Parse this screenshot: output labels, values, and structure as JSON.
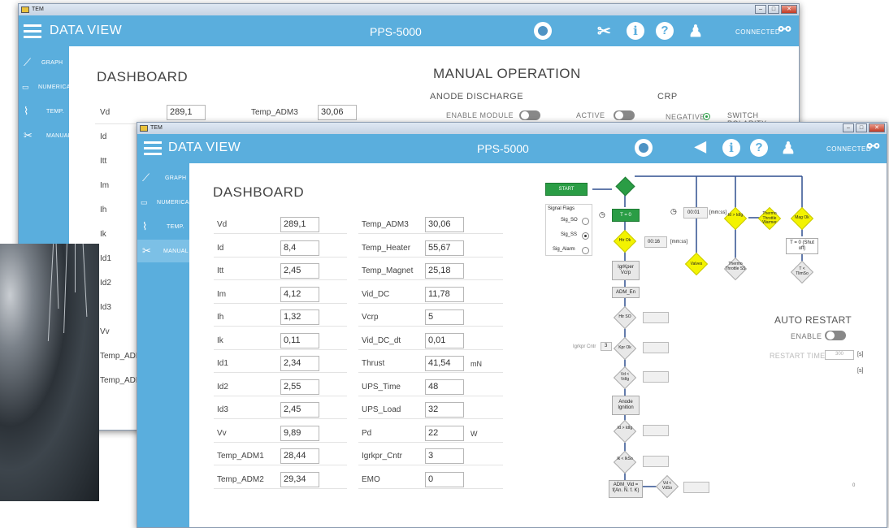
{
  "back_window": {
    "title": "TEM",
    "app_title": "Data View",
    "device": "PPS-5000",
    "connected": "CONNECTED",
    "nav": [
      "Graph",
      "Numerical",
      "Temp.",
      "Manual"
    ],
    "dashboard_title": "DASHBOARD",
    "manual_title": "MANUAL OPERATION",
    "anode_discharge": "ANODE DISCHARGE",
    "crp": "CRP",
    "enable_module": "ENABLE MODULE",
    "active": "ACTIVE",
    "negative": "NEGATIVE",
    "switch_polarity": "SWITCH POLARITY",
    "rows": [
      "Vd",
      "Id",
      "Itt",
      "Im",
      "Ih",
      "Ik",
      "Id1",
      "Id2",
      "Id3",
      "Vv",
      "Temp_ADM",
      "Temp_ADM"
    ],
    "vd_value": "289,1",
    "temp_adm3_label": "Temp_ADM3",
    "temp_adm3_value": "30,06"
  },
  "front_window": {
    "title": "TEM",
    "app_title": "Data View",
    "device": "PPS-5000",
    "connected": "CONNECTED",
    "nav": [
      "Graph",
      "Numerical",
      "Temp.",
      "Manual"
    ],
    "dashboard_title": "DASHBOARD",
    "left_rows": [
      {
        "label": "Vd",
        "value": "289,1"
      },
      {
        "label": "Id",
        "value": "8,4"
      },
      {
        "label": "Itt",
        "value": "2,45"
      },
      {
        "label": "Im",
        "value": "4,12"
      },
      {
        "label": "Ih",
        "value": "1,32"
      },
      {
        "label": "Ik",
        "value": "0,11"
      },
      {
        "label": "Id1",
        "value": "2,34"
      },
      {
        "label": "Id2",
        "value": "2,55"
      },
      {
        "label": "Id3",
        "value": "2,45"
      },
      {
        "label": "Vv",
        "value": "9,89"
      },
      {
        "label": "Temp_ADM1",
        "value": "28,44"
      },
      {
        "label": "Temp_ADM2",
        "value": "29,34"
      }
    ],
    "right_rows": [
      {
        "label": "Temp_ADM3",
        "value": "30,06",
        "unit": ""
      },
      {
        "label": "Temp_Heater",
        "value": "55,67",
        "unit": ""
      },
      {
        "label": "Temp_Magnet",
        "value": "25,18",
        "unit": ""
      },
      {
        "label": "Vid_DC",
        "value": "11,78",
        "unit": ""
      },
      {
        "label": "Vcrp",
        "value": "5",
        "unit": ""
      },
      {
        "label": "Vid_DC_dt",
        "value": "0,01",
        "unit": ""
      },
      {
        "label": "Thrust",
        "value": "41,54",
        "unit": "mN"
      },
      {
        "label": "UPS_Time",
        "value": "48",
        "unit": ""
      },
      {
        "label": "UPS_Load",
        "value": "32",
        "unit": ""
      },
      {
        "label": "Pd",
        "value": "22",
        "unit": "W"
      },
      {
        "label": "Igrkpr_Cntr",
        "value": "3",
        "unit": ""
      },
      {
        "label": "EMO",
        "value": "0",
        "unit": ""
      }
    ],
    "flowchart": {
      "start": "START",
      "t0": "T = 0",
      "signal_flags": "Signal Flags",
      "flags": [
        "Sig_SO",
        "Sig_SS",
        "Sig_Alarm"
      ],
      "timer1": "00:01",
      "timer2": "00:16",
      "timer_unit": "[mm:ss]",
      "htr_ok": "Htr Ok",
      "igrkpr_vcrp": "IgrKper Vcrp",
      "adm_en": "ADM_En",
      "htr_so": "Htr SO",
      "kpr_ok": "Kpr Ok",
      "igrkpr_cntr": "Igrkpr Cntr",
      "igrkpr_cntr_val": "3",
      "vd_vdig": "Vd < VdIg",
      "anode_ignition": "Anode Ignition",
      "id_idig": "Id > IdIg",
      "ik_ikso": "Ik < IkSo",
      "adm_vid": "ADM_Vid = f(An. N. f. K)",
      "vd_vdso": "Vd < VdSo",
      "valves": "Valves",
      "id_idig2": "Id > IdIg",
      "thermo_warmer": "Thermo Throttle Warmer",
      "thermo_ss": "Thermo Throttle SS",
      "mag_ok": "Mag Ok",
      "t0_shutoff": "T = 0 (Shut off)",
      "t_tlimso": "T < TlimSo"
    },
    "auto_restart": "AUTO RESTART",
    "enable": "ENABLE",
    "restart_time": "RESTART TIME",
    "restart_value": "300",
    "unit_s": "[s]",
    "unit_s2": "[s]",
    "zero": "0"
  }
}
